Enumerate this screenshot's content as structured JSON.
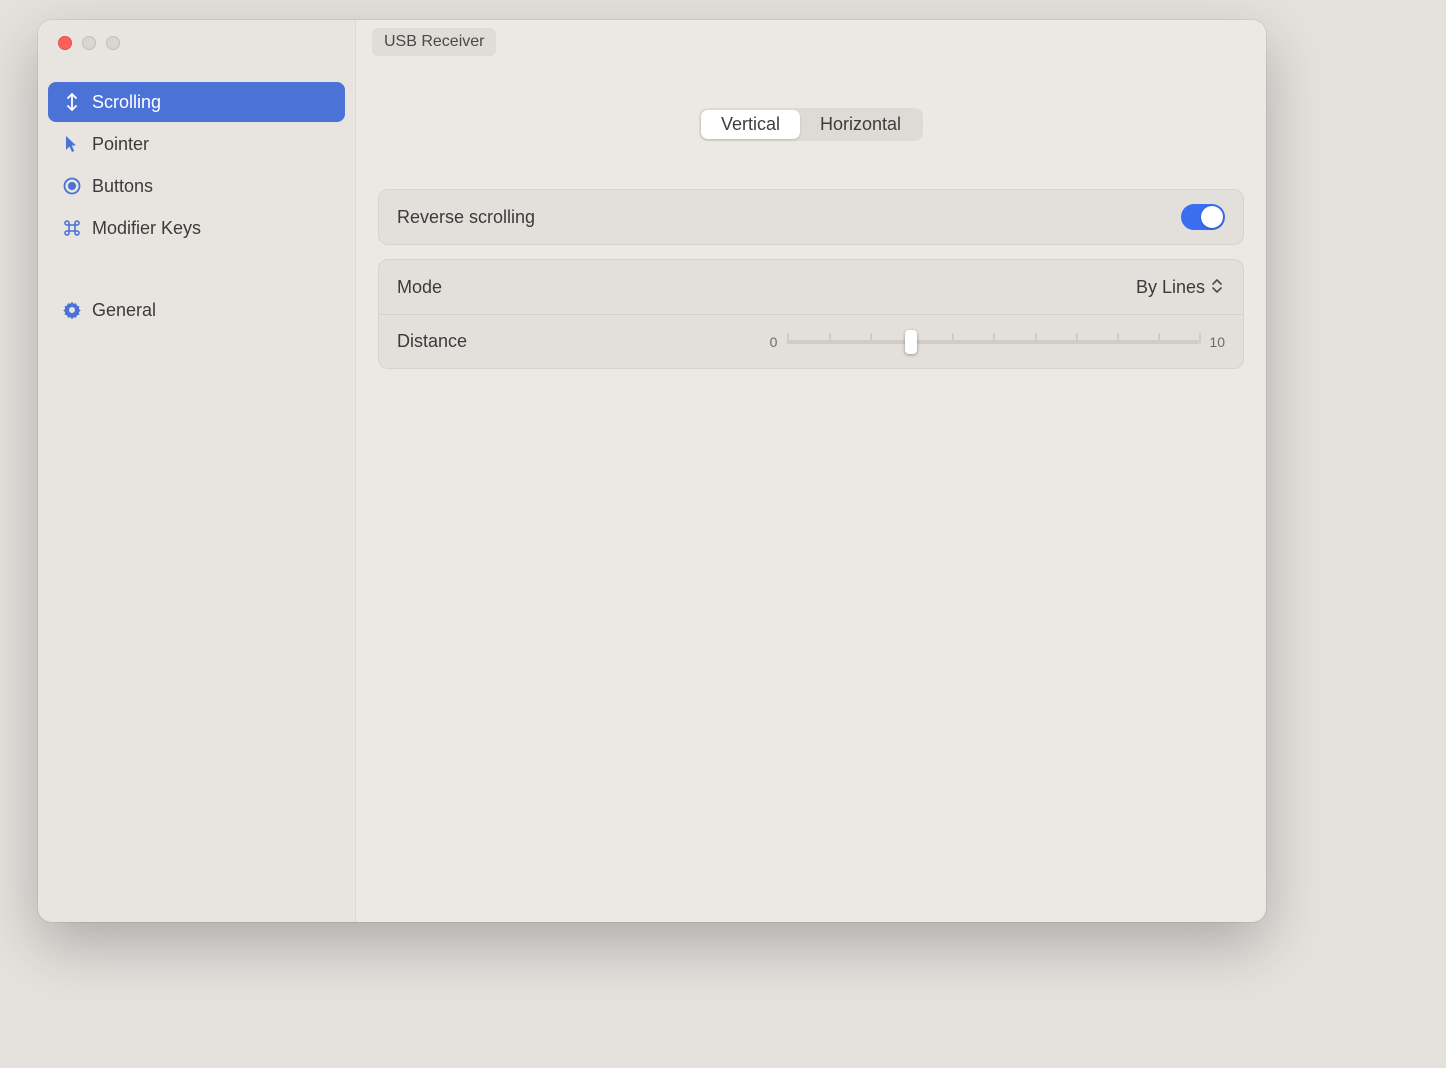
{
  "device_chip": "USB Receiver",
  "sidebar": {
    "items": [
      {
        "label": "Scrolling"
      },
      {
        "label": "Pointer"
      },
      {
        "label": "Buttons"
      },
      {
        "label": "Modifier Keys"
      },
      {
        "label": "General"
      }
    ]
  },
  "tabs": {
    "vertical": "Vertical",
    "horizontal": "Horizontal"
  },
  "settings": {
    "reverse_label": "Reverse scrolling",
    "reverse_on": true,
    "mode_label": "Mode",
    "mode_value": "By Lines",
    "distance_label": "Distance",
    "distance_min": "0",
    "distance_max": "10",
    "distance_value": 3,
    "distance_total": 10
  }
}
